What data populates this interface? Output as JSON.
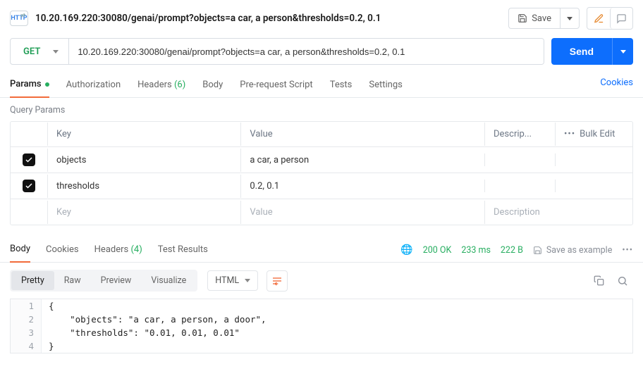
{
  "header": {
    "http_badge": "HTTP",
    "title": "10.20.169.220:30080/genai/prompt?objects=a car, a person&thresholds=0.2, 0.1",
    "save_label": "Save"
  },
  "request": {
    "method": "GET",
    "url": "10.20.169.220:30080/genai/prompt?objects=a car, a person&thresholds=0.2, 0.1",
    "send_label": "Send"
  },
  "tabs": {
    "params": "Params",
    "authorization": "Authorization",
    "headers": "Headers",
    "headers_count": "(6)",
    "body": "Body",
    "prerequest": "Pre-request Script",
    "tests": "Tests",
    "settings": "Settings",
    "cookies": "Cookies"
  },
  "query": {
    "section_label": "Query Params",
    "head_key": "Key",
    "head_value": "Value",
    "head_desc": "Descrip...",
    "bulk_edit": "Bulk Edit",
    "rows": [
      {
        "key": "objects",
        "value": "a car, a person",
        "desc": ""
      },
      {
        "key": "thresholds",
        "value": "0.2, 0.1",
        "desc": ""
      }
    ],
    "ph_key": "Key",
    "ph_value": "Value",
    "ph_desc": "Description"
  },
  "response": {
    "tabs": {
      "body": "Body",
      "cookies": "Cookies",
      "headers": "Headers",
      "headers_count": "(4)",
      "tests": "Test Results"
    },
    "status_text": "200 OK",
    "time": "233 ms",
    "size": "222 B",
    "save_example": "Save as example",
    "view": {
      "pretty": "Pretty",
      "raw": "Raw",
      "preview": "Preview",
      "visualize": "Visualize",
      "lang": "HTML"
    },
    "lines": [
      "{",
      "    \"objects\": \"a car, a person, a door\",",
      "    \"thresholds\": \"0.01, 0.01, 0.01\"",
      "}"
    ]
  }
}
